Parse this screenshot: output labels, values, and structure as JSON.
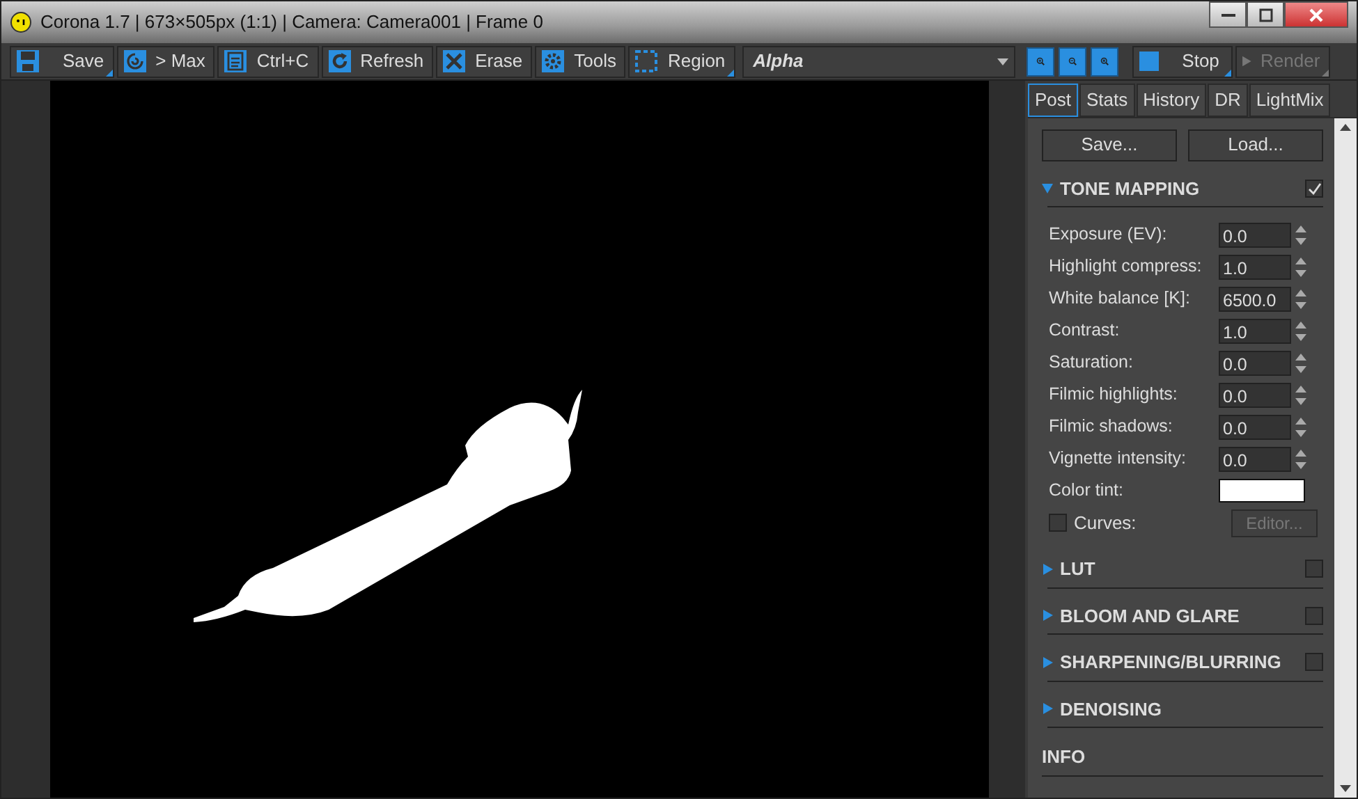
{
  "window": {
    "title": "Corona 1.7 | 673×505px (1:1) | Camera: Camera001 | Frame 0"
  },
  "toolbar": {
    "buttons": [
      {
        "kind": "save",
        "label": "Save",
        "dropdown": true
      },
      {
        "kind": "max",
        "label": "> Max",
        "dropdown": false
      },
      {
        "kind": "copy",
        "label": "Ctrl+C",
        "dropdown": false
      },
      {
        "kind": "refresh",
        "label": "Refresh",
        "dropdown": false
      },
      {
        "kind": "erase",
        "label": "Erase",
        "dropdown": false
      },
      {
        "kind": "tools",
        "label": "Tools",
        "dropdown": false
      },
      {
        "kind": "region",
        "label": "Region",
        "dropdown": true
      }
    ],
    "channel": "Alpha",
    "zoom": [
      {
        "kind": "zoom-in"
      },
      {
        "kind": "zoom-out"
      },
      {
        "kind": "zoom-fit"
      }
    ],
    "actions": [
      {
        "kind": "stop",
        "label": "Stop",
        "disabled": false,
        "dropdown": true
      },
      {
        "kind": "render",
        "label": "Render",
        "disabled": true,
        "dropdown": true
      }
    ]
  },
  "tabs": [
    {
      "label": "Post",
      "selected": true
    },
    {
      "label": "Stats",
      "selected": false
    },
    {
      "label": "History",
      "selected": false
    },
    {
      "label": "DR",
      "selected": false
    },
    {
      "label": "LightMix",
      "selected": false
    }
  ],
  "panel_buttons": [
    "Save...",
    "Load..."
  ],
  "sections": [
    {
      "kind": "toggle",
      "title": "TONE MAPPING",
      "expanded": true,
      "checked": true,
      "fields": [
        {
          "label": "Exposure (EV):",
          "value": "0.0"
        },
        {
          "label": "Highlight compress:",
          "value": "1.0"
        },
        {
          "label": "White balance [K]:",
          "value": "6500.0"
        },
        {
          "label": "Contrast:",
          "value": "1.0"
        },
        {
          "label": "Saturation:",
          "value": "0.0"
        },
        {
          "label": "Filmic highlights:",
          "value": "0.0"
        },
        {
          "label": "Filmic shadows:",
          "value": "0.0"
        },
        {
          "label": "Vignette intensity:",
          "value": "0.0"
        }
      ],
      "color_tint": {
        "label": "Color tint:",
        "color": "#ffffff"
      },
      "curves": {
        "label": "Curves:",
        "checked": false,
        "button": "Editor...",
        "button_disabled": true
      }
    },
    {
      "kind": "toggle",
      "title": "LUT",
      "expanded": false,
      "checked": false
    },
    {
      "kind": "toggle",
      "title": "BLOOM AND GLARE",
      "expanded": false,
      "checked": false
    },
    {
      "kind": "toggle",
      "title": "SHARPENING/BLURRING",
      "expanded": false,
      "checked": false
    },
    {
      "kind": "plain",
      "title": "DENOISING",
      "expanded": false
    },
    {
      "kind": "heading",
      "title": "INFO"
    }
  ]
}
